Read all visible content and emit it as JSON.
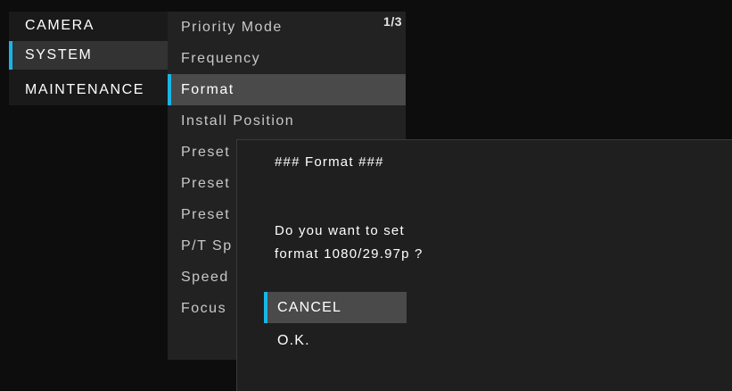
{
  "left_menu": {
    "items": [
      {
        "label": "CAMERA"
      },
      {
        "label": "SYSTEM",
        "selected": true
      },
      {
        "label": "MAINTENANCE"
      }
    ]
  },
  "sub_menu": {
    "page_indicator": "1/3",
    "items": [
      {
        "label": "Priority Mode"
      },
      {
        "label": "Frequency"
      },
      {
        "label": "Format",
        "selected": true
      },
      {
        "label": "Install Position"
      },
      {
        "label": "Preset"
      },
      {
        "label": "Preset"
      },
      {
        "label": "Preset"
      },
      {
        "label": "P/T Sp"
      },
      {
        "label": "Speed"
      },
      {
        "label": "Focus"
      }
    ]
  },
  "dialog": {
    "title": "### Format ###",
    "message_line1": "Do you want to set",
    "message_line2": "format 1080/29.97p ?",
    "options": {
      "cancel": "CANCEL",
      "ok": "O.K."
    },
    "selected_option": "cancel"
  },
  "colors": {
    "accent": "#19b5e6",
    "background": "#0d0d0d",
    "highlight": "#4a4a4a"
  }
}
